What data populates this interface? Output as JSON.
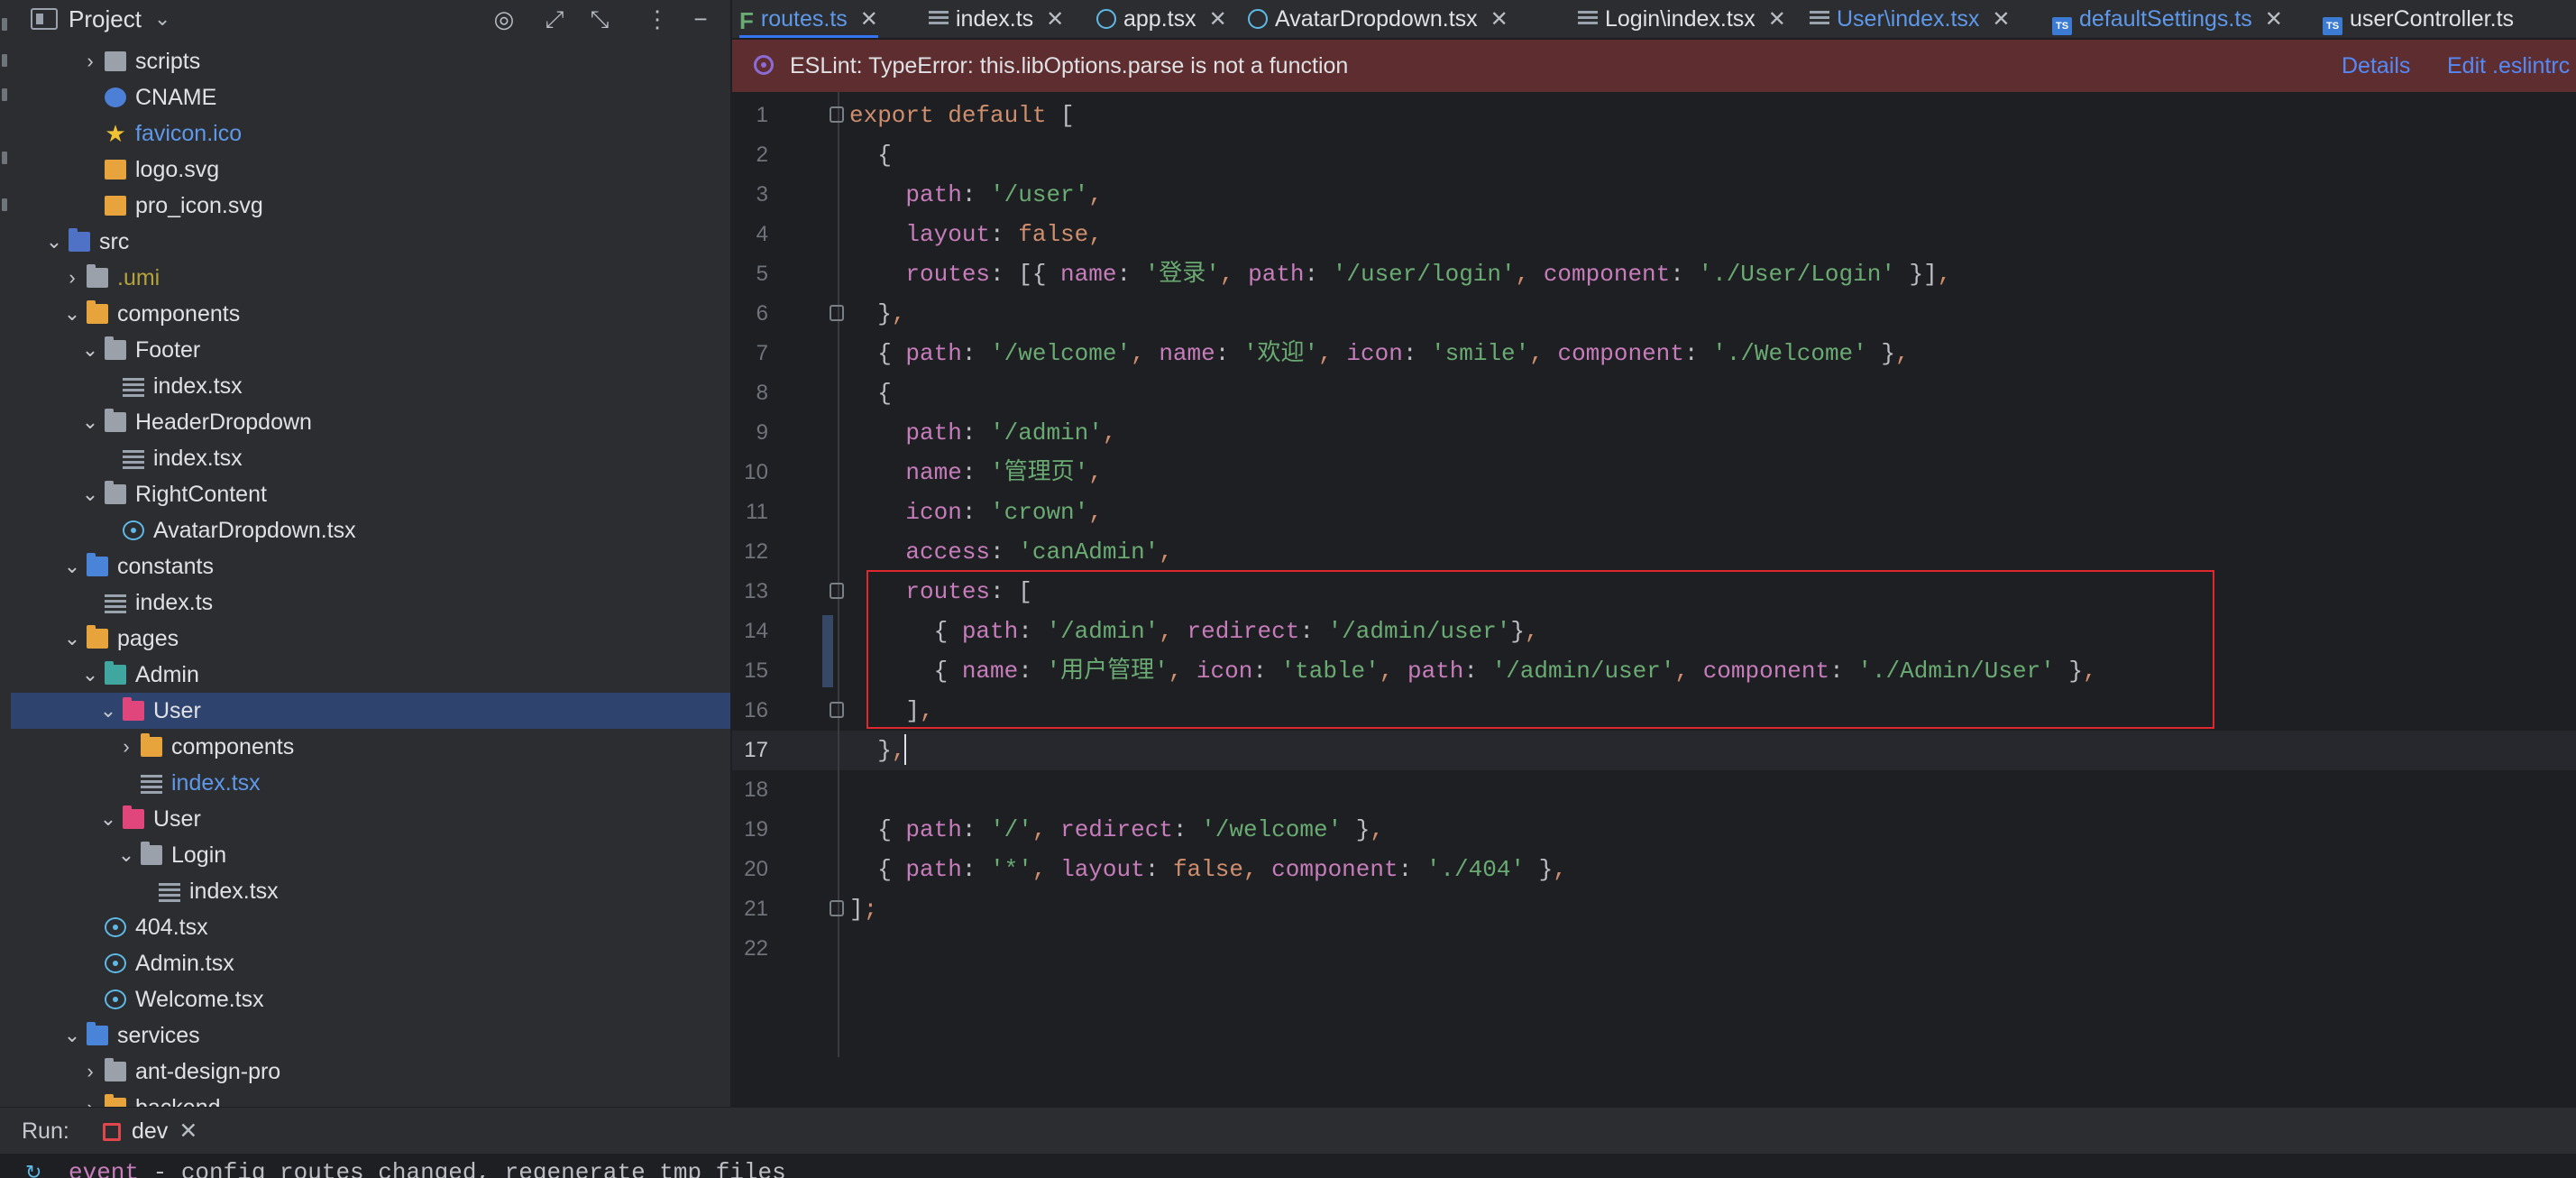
{
  "project_panel": {
    "title": "Project",
    "tree": [
      {
        "label": "scripts",
        "chevron": "›",
        "icon": "script-folder",
        "style": "normal"
      },
      {
        "label": "CNAME",
        "chevron": "",
        "icon": "globe",
        "style": "normal"
      },
      {
        "label": "favicon.ico",
        "chevron": "",
        "icon": "star",
        "style": "link"
      },
      {
        "label": "logo.svg",
        "chevron": "",
        "icon": "svgfile",
        "style": "normal"
      },
      {
        "label": "pro_icon.svg",
        "chevron": "",
        "icon": "svgfile",
        "style": "normal"
      },
      {
        "label": "src",
        "chevron": "⌄",
        "icon": "folder-src",
        "style": "normal"
      },
      {
        "label": ".umi",
        "chevron": "›",
        "icon": "folder",
        "style": "dim"
      },
      {
        "label": "components",
        "chevron": "⌄",
        "icon": "folder-orange",
        "style": "normal"
      },
      {
        "label": "Footer",
        "chevron": "⌄",
        "icon": "folder",
        "style": "normal"
      },
      {
        "label": "index.tsx",
        "chevron": "",
        "icon": "file-lines",
        "style": "normal"
      },
      {
        "label": "HeaderDropdown",
        "chevron": "⌄",
        "icon": "folder",
        "style": "normal"
      },
      {
        "label": "index.tsx",
        "chevron": "",
        "icon": "file-lines",
        "style": "normal"
      },
      {
        "label": "RightContent",
        "chevron": "⌄",
        "icon": "folder",
        "style": "normal"
      },
      {
        "label": "AvatarDropdown.tsx",
        "chevron": "",
        "icon": "react",
        "style": "normal"
      },
      {
        "label": "constants",
        "chevron": "⌄",
        "icon": "folder-blue",
        "style": "normal"
      },
      {
        "label": "index.ts",
        "chevron": "",
        "icon": "file-lines",
        "style": "normal"
      },
      {
        "label": "pages",
        "chevron": "⌄",
        "icon": "folder-orange",
        "style": "normal"
      },
      {
        "label": "Admin",
        "chevron": "⌄",
        "icon": "folder-teal",
        "style": "normal"
      },
      {
        "label": "User",
        "chevron": "⌄",
        "icon": "folder-pink",
        "style": "selected"
      },
      {
        "label": "components",
        "chevron": "›",
        "icon": "folder-orange",
        "style": "normal"
      },
      {
        "label": "index.tsx",
        "chevron": "",
        "icon": "file-lines",
        "style": "link"
      },
      {
        "label": "User",
        "chevron": "⌄",
        "icon": "folder-pink",
        "style": "normal"
      },
      {
        "label": "Login",
        "chevron": "⌄",
        "icon": "folder",
        "style": "normal"
      },
      {
        "label": "index.tsx",
        "chevron": "",
        "icon": "file-lines",
        "style": "normal"
      },
      {
        "label": "404.tsx",
        "chevron": "",
        "icon": "react",
        "style": "normal"
      },
      {
        "label": "Admin.tsx",
        "chevron": "",
        "icon": "react",
        "style": "normal"
      },
      {
        "label": "Welcome.tsx",
        "chevron": "",
        "icon": "react",
        "style": "normal"
      },
      {
        "label": "services",
        "chevron": "⌄",
        "icon": "folder-blue",
        "style": "normal"
      },
      {
        "label": "ant-design-pro",
        "chevron": "›",
        "icon": "folder",
        "style": "normal"
      },
      {
        "label": "backend",
        "chevron": "›",
        "icon": "folder-orange",
        "style": "normal"
      }
    ]
  },
  "tabs": [
    {
      "label": "routes.ts",
      "icon": "routes",
      "active": true,
      "link": true
    },
    {
      "label": "index.ts",
      "icon": "lines",
      "active": false,
      "link": false
    },
    {
      "label": "app.tsx",
      "icon": "react",
      "active": false,
      "link": false
    },
    {
      "label": "AvatarDropdown.tsx",
      "icon": "react",
      "active": false,
      "link": false
    },
    {
      "label": "Login\\index.tsx",
      "icon": "lines",
      "active": false,
      "link": false
    },
    {
      "label": "User\\index.tsx",
      "icon": "lines",
      "active": false,
      "link": true
    },
    {
      "label": "defaultSettings.ts",
      "icon": "ts",
      "active": false,
      "link": true
    },
    {
      "label": "userController.ts",
      "icon": "ts",
      "active": false,
      "link": false
    }
  ],
  "eslint": {
    "message": "ESLint: TypeError: this.libOptions.parse is not a function",
    "details": "Details",
    "edit": "Edit .eslintrc"
  },
  "code_lines": [
    [
      [
        "k",
        "export default "
      ],
      [
        "o",
        "["
      ]
    ],
    [
      [
        "o",
        "  {"
      ]
    ],
    [
      [
        "p",
        "    path"
      ],
      [
        "o",
        ": "
      ],
      [
        "s",
        "'/user'"
      ],
      [
        "k",
        ","
      ]
    ],
    [
      [
        "p",
        "    layout"
      ],
      [
        "o",
        ": "
      ],
      [
        "k",
        "false,"
      ]
    ],
    [
      [
        "p",
        "    routes"
      ],
      [
        "o",
        ": [{ "
      ],
      [
        "p",
        "name"
      ],
      [
        "o",
        ": "
      ],
      [
        "s",
        "'登录'"
      ],
      [
        "k",
        ", "
      ],
      [
        "p",
        "path"
      ],
      [
        "o",
        ": "
      ],
      [
        "s",
        "'/user/login'"
      ],
      [
        "k",
        ", "
      ],
      [
        "p",
        "component"
      ],
      [
        "o",
        ": "
      ],
      [
        "s",
        "'./User/Login'"
      ],
      [
        "o",
        " }]"
      ],
      [
        "k",
        ","
      ]
    ],
    [
      [
        "o",
        "  }"
      ],
      [
        "k",
        ","
      ]
    ],
    [
      [
        "o",
        "  { "
      ],
      [
        "p",
        "path"
      ],
      [
        "o",
        ": "
      ],
      [
        "s",
        "'/welcome'"
      ],
      [
        "k",
        ", "
      ],
      [
        "p",
        "name"
      ],
      [
        "o",
        ": "
      ],
      [
        "s",
        "'欢迎'"
      ],
      [
        "k",
        ", "
      ],
      [
        "p",
        "icon"
      ],
      [
        "o",
        ": "
      ],
      [
        "s",
        "'smile'"
      ],
      [
        "k",
        ", "
      ],
      [
        "p",
        "component"
      ],
      [
        "o",
        ": "
      ],
      [
        "s",
        "'./Welcome'"
      ],
      [
        "o",
        " }"
      ],
      [
        "k",
        ","
      ]
    ],
    [
      [
        "o",
        "  {"
      ]
    ],
    [
      [
        "p",
        "    path"
      ],
      [
        "o",
        ": "
      ],
      [
        "s",
        "'/admin'"
      ],
      [
        "k",
        ","
      ]
    ],
    [
      [
        "p",
        "    name"
      ],
      [
        "o",
        ": "
      ],
      [
        "s",
        "'管理页'"
      ],
      [
        "k",
        ","
      ]
    ],
    [
      [
        "p",
        "    icon"
      ],
      [
        "o",
        ": "
      ],
      [
        "s",
        "'crown'"
      ],
      [
        "k",
        ","
      ]
    ],
    [
      [
        "p",
        "    access"
      ],
      [
        "o",
        ": "
      ],
      [
        "s",
        "'canAdmin'"
      ],
      [
        "k",
        ","
      ]
    ],
    [
      [
        "p",
        "    routes"
      ],
      [
        "o",
        ": ["
      ]
    ],
    [
      [
        "o",
        "      { "
      ],
      [
        "p",
        "path"
      ],
      [
        "o",
        ": "
      ],
      [
        "s",
        "'/admin'"
      ],
      [
        "k",
        ", "
      ],
      [
        "p",
        "redirect"
      ],
      [
        "o",
        ": "
      ],
      [
        "s",
        "'/admin/user'"
      ],
      [
        "o",
        "}"
      ],
      [
        "k",
        ","
      ]
    ],
    [
      [
        "o",
        "      { "
      ],
      [
        "p",
        "name"
      ],
      [
        "o",
        ": "
      ],
      [
        "s",
        "'用户管理'"
      ],
      [
        "k",
        ", "
      ],
      [
        "p",
        "icon"
      ],
      [
        "o",
        ": "
      ],
      [
        "s",
        "'table'"
      ],
      [
        "k",
        ", "
      ],
      [
        "p",
        "path"
      ],
      [
        "o",
        ": "
      ],
      [
        "s",
        "'/admin/user'"
      ],
      [
        "k",
        ", "
      ],
      [
        "p",
        "component"
      ],
      [
        "o",
        ": "
      ],
      [
        "s",
        "'./Admin/User'"
      ],
      [
        "o",
        " }"
      ],
      [
        "k",
        ","
      ]
    ],
    [
      [
        "o",
        "    ]"
      ],
      [
        "k",
        ","
      ]
    ],
    [
      [
        "o",
        "  }"
      ],
      [
        "k",
        ","
      ]
    ],
    [
      [
        "o",
        ""
      ]
    ],
    [
      [
        "o",
        "  { "
      ],
      [
        "p",
        "path"
      ],
      [
        "o",
        ": "
      ],
      [
        "s",
        "'/'"
      ],
      [
        "k",
        ", "
      ],
      [
        "p",
        "redirect"
      ],
      [
        "o",
        ": "
      ],
      [
        "s",
        "'/welcome'"
      ],
      [
        "o",
        " }"
      ],
      [
        "k",
        ","
      ]
    ],
    [
      [
        "o",
        "  { "
      ],
      [
        "p",
        "path"
      ],
      [
        "o",
        ": "
      ],
      [
        "s",
        "'*'"
      ],
      [
        "k",
        ", "
      ],
      [
        "p",
        "layout"
      ],
      [
        "o",
        ": "
      ],
      [
        "k",
        "false, "
      ],
      [
        "p",
        "component"
      ],
      [
        "o",
        ": "
      ],
      [
        "s",
        "'./404'"
      ],
      [
        "o",
        " }"
      ],
      [
        "k",
        ","
      ]
    ],
    [
      [
        "o",
        "]"
      ],
      [
        "k",
        ";"
      ]
    ],
    [
      [
        "o",
        ""
      ]
    ]
  ],
  "current_line": 17,
  "run": {
    "label": "Run:",
    "tab": "dev"
  },
  "console": {
    "event": "event",
    "text": " - config routes changed, regenerate tmp files"
  }
}
